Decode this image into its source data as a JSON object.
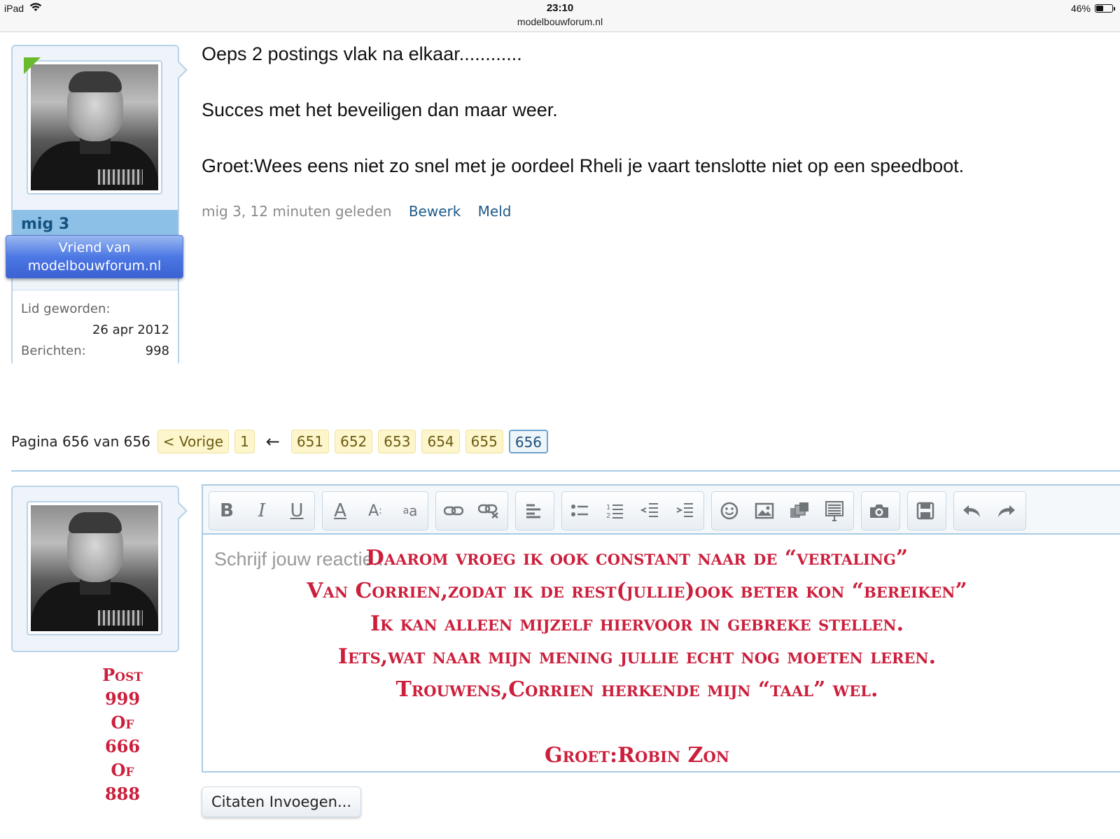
{
  "status_bar": {
    "device": "iPad",
    "time": "23:10",
    "url": "modelbouwforum.nl",
    "battery": "46%",
    "battery_level": 0.46
  },
  "post": {
    "author": "mig 3",
    "user_title": "Vriend van modelbouwforum.nl",
    "joined_label": "Lid geworden:",
    "joined_value": "26 apr 2012",
    "messages_label": "Berichten:",
    "messages_value": "998",
    "lines": [
      "Oeps 2 postings vlak na elkaar............",
      "Succes met het beveiligen dan maar weer.",
      "Groet:Wees eens niet zo snel met je oordeel Rheli je vaart tenslotte niet op een speedboot."
    ],
    "meta_time": "mig 3, 12 minuten geleden",
    "edit_link": "Bewerk",
    "report_link": "Meld"
  },
  "pagination": {
    "label": "Pagina 656 van 656",
    "prev": "< Vorige",
    "first": "1",
    "ellipsis_arrow": "←",
    "pages": [
      "651",
      "652",
      "653",
      "654",
      "655",
      "656"
    ],
    "current": "656"
  },
  "reply": {
    "post_counter": [
      "Post",
      "999",
      "Of",
      "666",
      "Of",
      "888"
    ],
    "placeholder": "Schrijf jouw reactie...",
    "overlay_lines": [
      "Daarom vroeg ik ook constant naar de “vertaling”",
      "Van Corrien,zodat ik de rest(jullie)ook beter kon “bereiken”",
      "Ik kan alleen mijzelf hiervoor in gebreke stellen.",
      "Iets,wat naar mijn mening jullie echt nog moeten leren.",
      "Trouwens,Corrien herkende mijn “taal” wel.",
      "",
      "Groet:Robin Zon"
    ],
    "insert_quotes_label": "Citaten Invoegen...",
    "toolbar": [
      [
        "bold-icon",
        "italic-icon",
        "underline-icon"
      ],
      [
        "text-color-icon",
        "font-size-icon",
        "remove-format-icon"
      ],
      [
        "link-icon",
        "unlink-icon"
      ],
      [
        "align-icon"
      ],
      [
        "bullet-list-icon",
        "numbered-list-icon",
        "outdent-icon",
        "indent-icon"
      ],
      [
        "smiley-icon",
        "image-icon",
        "media-icon",
        "code-icon"
      ],
      [
        "camera-icon"
      ],
      [
        "save-draft-icon"
      ],
      [
        "undo-icon",
        "redo-icon"
      ]
    ]
  },
  "colors": {
    "accent_blue": "#1d5a8a",
    "overlay_red": "#cc1f3c",
    "page_btn_bg": "#fdf6cc",
    "online": "#6aba2e"
  }
}
